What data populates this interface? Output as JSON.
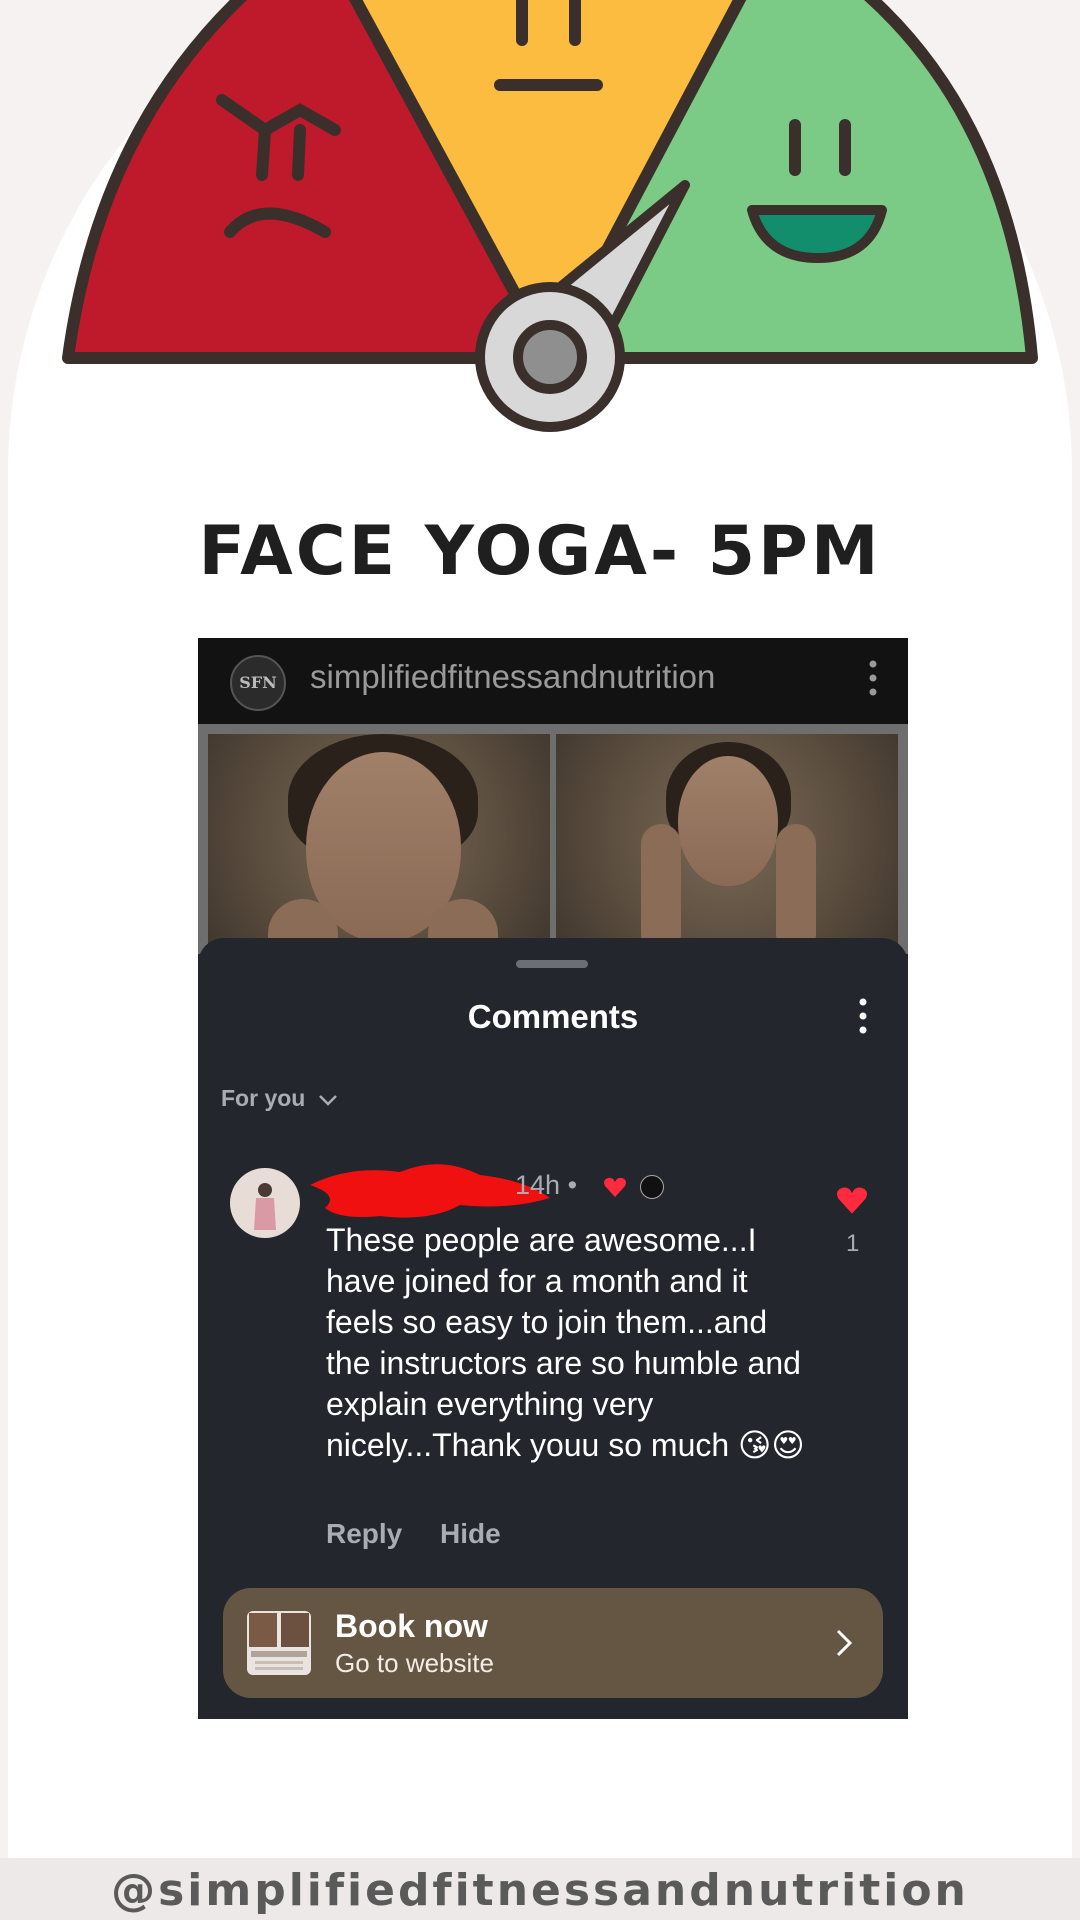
{
  "header": {
    "headline": "FACE YOGA- 5PM"
  },
  "mood_meter": {
    "colors": {
      "angry": "#be1a2b",
      "neutral": "#fcbc3f",
      "happy": "#7bcb86",
      "needle": "#d8d8d8"
    },
    "icons": [
      "angry-face-icon",
      "neutral-face-icon",
      "happy-face-icon",
      "gauge-needle-icon"
    ]
  },
  "post": {
    "account_logo": "SFN",
    "username": "simplifiedfitnessandnutrition"
  },
  "comments_sheet": {
    "title": "Comments",
    "filter_label": "For you",
    "comment": {
      "time": "14h",
      "text": "These people are awesome...I have joined for a month and it feels so easy to join them...and the instructors are so humble and explain everything very nicely...Thank youu so much 😘😍",
      "reply_label": "Reply",
      "hide_label": "Hide",
      "like_count": "1"
    },
    "cta": {
      "title": "Book now",
      "subtitle": "Go to website"
    }
  },
  "footer": {
    "handle": "@simplifiedfitnessandnutrition"
  }
}
